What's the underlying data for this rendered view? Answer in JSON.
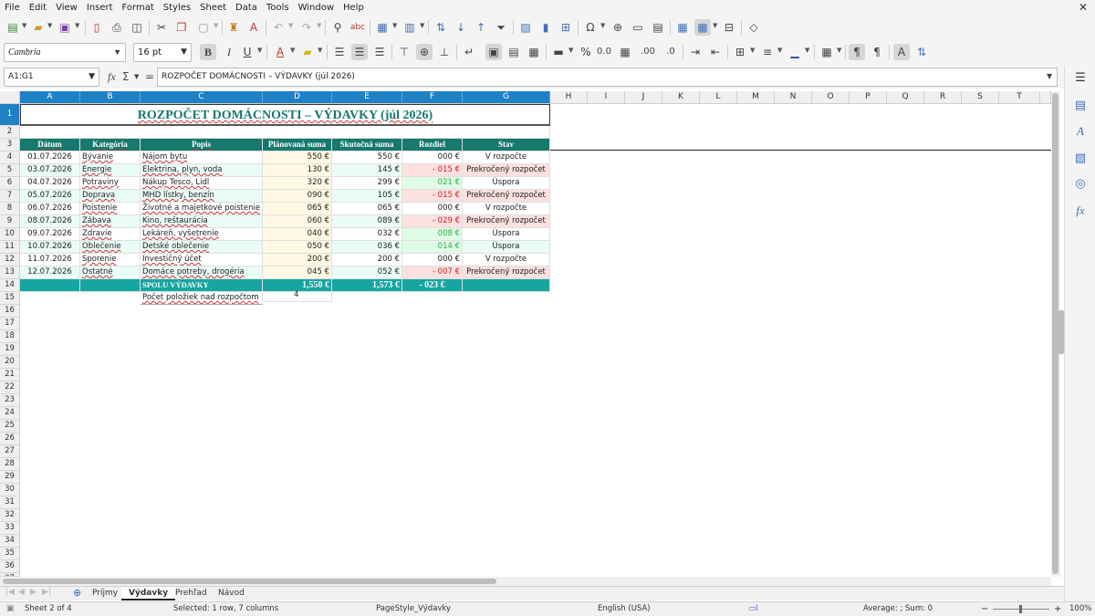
{
  "menu": [
    "File",
    "Edit",
    "View",
    "Insert",
    "Format",
    "Styles",
    "Sheet",
    "Data",
    "Tools",
    "Window",
    "Help"
  ],
  "toolbar": {
    "font_name": "Cambria",
    "font_size": "16 pt"
  },
  "name_box": "A1:G1",
  "formula_bar": {
    "content": "ROZPOČET DOMÁCNOSTI – VÝDAVKY (júl 2026)"
  },
  "columns": [
    "A",
    "B",
    "C",
    "D",
    "E",
    "F",
    "G",
    "H",
    "I",
    "J",
    "K",
    "L",
    "M",
    "N",
    "O",
    "P",
    "Q",
    "R",
    "S",
    "T"
  ],
  "rows": [
    "1",
    "2",
    "3",
    "4",
    "5",
    "6",
    "7",
    "8",
    "9",
    "10",
    "11",
    "12",
    "13",
    "14",
    "15",
    "16",
    "17",
    "18",
    "19",
    "20",
    "21",
    "22",
    "23",
    "24",
    "25",
    "26",
    "27",
    "28",
    "29",
    "30",
    "31",
    "32",
    "33",
    "34",
    "35",
    "36",
    "37"
  ],
  "sheet": {
    "title": "ROZPOČET DOMÁCNOSTI – VÝDAVKY (júl 2026)",
    "headers": [
      "Dátum",
      "Kategória",
      "Popis",
      "Plánovaná suma",
      "Skutočná suma",
      "Rozdiel",
      "Stav"
    ],
    "rows": [
      [
        "01.07.2026",
        "Bývanie",
        "Nájom bytu",
        "550 €",
        "550 €",
        "000 €",
        "V rozpočte"
      ],
      [
        "03.07.2026",
        "Energie",
        "Elektrina, plyn, voda",
        "130 €",
        "145 €",
        "- 015 €",
        "Prekročený rozpočet"
      ],
      [
        "04.07.2026",
        "Potraviny",
        "Nákup Tesco, Lidl",
        "320 €",
        "299 €",
        "021 €",
        "Úspora"
      ],
      [
        "05.07.2026",
        "Doprava",
        "MHD lístky, benzín",
        "090 €",
        "105 €",
        "- 015 €",
        "Prekročený rozpočet"
      ],
      [
        "06.07.2026",
        "Poistenie",
        "Životné a majetkové poistenie",
        "065 €",
        "065 €",
        "000 €",
        "V rozpočte"
      ],
      [
        "08.07.2026",
        "Zábava",
        "Kino, reštaurácia",
        "060 €",
        "089 €",
        "- 029 €",
        "Prekročený rozpočet"
      ],
      [
        "09.07.2026",
        "Zdravie",
        "Lekáreň, vyšetrenie",
        "040 €",
        "032 €",
        "008 €",
        "Úspora"
      ],
      [
        "10.07.2026",
        "Oblečenie",
        "Detské oblečenie",
        "050 €",
        "036 €",
        "014 €",
        "Úspora"
      ],
      [
        "11.07.2026",
        "Sporenie",
        "Investičný účet",
        "200 €",
        "200 €",
        "000 €",
        "V rozpočte"
      ],
      [
        "12.07.2026",
        "Ostatné",
        "Domáce potreby, drogéria",
        "045 €",
        "052 €",
        "- 007 €",
        "Prekročený rozpočet"
      ]
    ],
    "total": {
      "label": "SPOLU VÝDAVKY",
      "planned": "1,550 €",
      "actual": "1,573 €",
      "diff": "- 023 €"
    },
    "over_budget": {
      "label": "Počet položiek nad rozpočtom",
      "value": "4"
    }
  },
  "sheet_tabs": [
    "Príjmy",
    "Výdavky",
    "Prehľad",
    "Návod"
  ],
  "active_tab": "Výdavky",
  "status": {
    "sheet": "Sheet 2 of 4",
    "selection": "Selected: 1 row, 7 columns",
    "page_style": "PageStyle_Výdavky",
    "language": "English (USA)",
    "summary": "Average: ; Sum: 0",
    "zoom": "100%"
  },
  "colors": {
    "header": "#17786d",
    "total": "#17a5a1",
    "selection": "#1e81c5",
    "over": "#fde0e0",
    "under": "#e0fbe6",
    "row_even": "#eafcf6",
    "planned_bg": "#fef9e4",
    "neg_text": "#d01f1f",
    "pos_text": "#2fae3e"
  }
}
